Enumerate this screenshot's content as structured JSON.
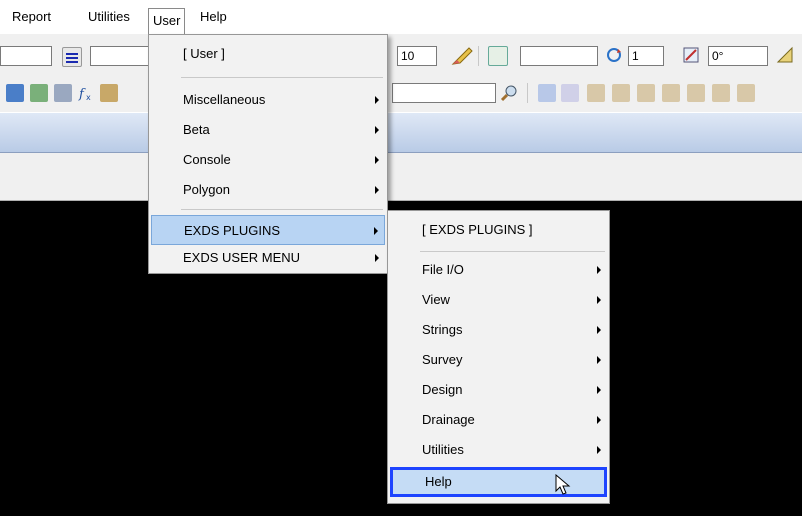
{
  "menubar": {
    "items": [
      "Report",
      "Utilities",
      "User",
      "Help"
    ]
  },
  "toolbar1": {
    "field_10": "10",
    "field_1": "1",
    "field_angle": "0°"
  },
  "user_menu": {
    "header": "[ User ]",
    "items": [
      {
        "label": "Miscellaneous",
        "submenu": true
      },
      {
        "label": "Beta",
        "submenu": true
      },
      {
        "label": "Console",
        "submenu": true
      },
      {
        "label": "Polygon",
        "submenu": true
      },
      {
        "label": "EXDS PLUGINS",
        "submenu": true,
        "highlighted": true
      },
      {
        "label": "EXDS USER MENU",
        "submenu": true
      }
    ]
  },
  "exds_menu": {
    "header": "[ EXDS PLUGINS ]",
    "items": [
      {
        "label": "File I/O",
        "submenu": true
      },
      {
        "label": "View",
        "submenu": true
      },
      {
        "label": "Strings",
        "submenu": true
      },
      {
        "label": "Survey",
        "submenu": true
      },
      {
        "label": "Design",
        "submenu": true
      },
      {
        "label": "Drainage",
        "submenu": true
      },
      {
        "label": "Utilities",
        "submenu": true
      },
      {
        "label": "Help",
        "submenu": false,
        "highlighted": true
      }
    ]
  },
  "colors": {
    "highlight": "#b8d4f3",
    "focus_border": "#1e44ff"
  }
}
